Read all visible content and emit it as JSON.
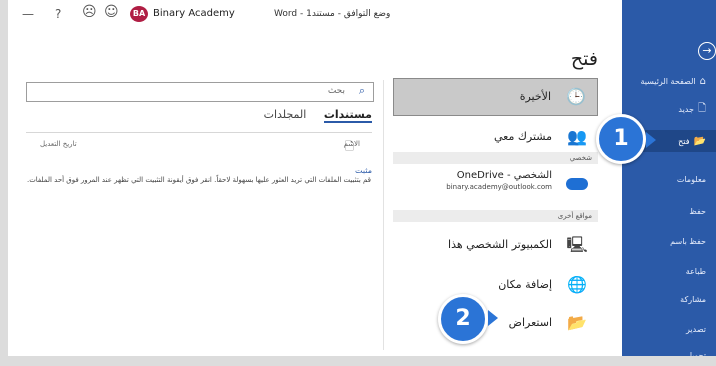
{
  "titlebar": {
    "minimize": "—",
    "help": "?",
    "emoji_sad": "☹",
    "emoji_happy": "☺",
    "account_initials": "BA",
    "account_name": "Binary Academy",
    "doc_title": "Word - وضع التوافق - مستند1"
  },
  "nav": {
    "items": [
      {
        "label": "الصفحة الرئيسية",
        "icon": "home-icon"
      },
      {
        "label": "جديد",
        "icon": "new-doc-icon"
      },
      {
        "label": "فتح",
        "icon": "folder-open-icon"
      },
      {
        "label": "معلومات"
      },
      {
        "label": "حفظ"
      },
      {
        "label": "حفظ باسم"
      },
      {
        "label": "طباعة"
      },
      {
        "label": "مشاركة"
      },
      {
        "label": "تصدير"
      },
      {
        "label": "تحويل"
      }
    ]
  },
  "page": {
    "title": "فتح"
  },
  "locations": {
    "recent": "الأخيرة",
    "shared": "مشترك معي",
    "section_personal": "شخصي",
    "onedrive_name": "OneDrive - الشخصي",
    "onedrive_email": "binary.academy@outlook.com",
    "section_other": "مواقع أخرى",
    "this_pc": "الكمبيوتر الشخصي هذا",
    "add_place": "إضافة مكان",
    "browse": "استعراض"
  },
  "search": {
    "placeholder": "بحث"
  },
  "tabs": {
    "documents": "مستندات",
    "folders": "المجلدات"
  },
  "columns": {
    "name": "الاسم",
    "date_modified": "تاريخ التعديل"
  },
  "pinned": {
    "title": "مثبت",
    "text": "قم بتثبيت الملفات التي تريد العثور عليها بسهولة لاحقاً. انقر فوق أيقونة التثبيت التي تظهر عند المرور فوق أحد الملفات."
  },
  "callouts": {
    "one": "1",
    "two": "2"
  }
}
